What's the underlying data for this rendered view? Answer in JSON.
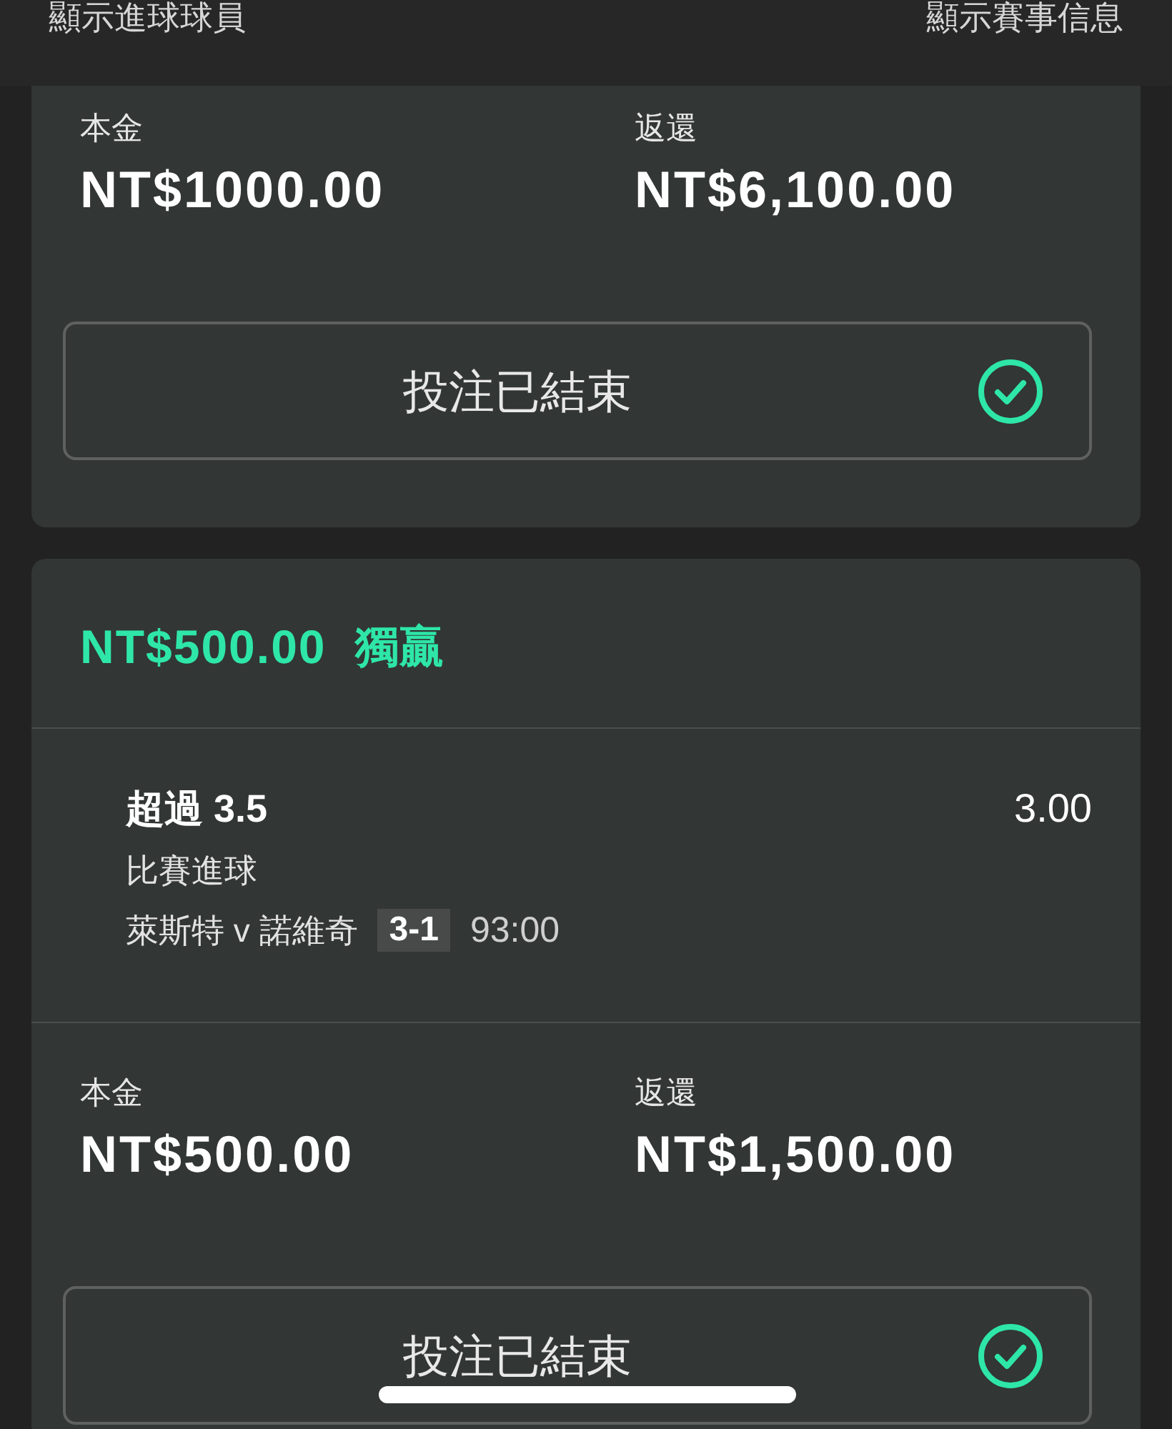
{
  "top_bar": {
    "left_link": "顯示進球球員",
    "right_link": "顯示賽事信息"
  },
  "bets": [
    {
      "stake_label": "本金",
      "stake": "NT$1000.00",
      "return_label": "返還",
      "return": "NT$6,100.00",
      "status": "投注已結束",
      "settled": true
    },
    {
      "amount": "NT$500.00",
      "bet_type": "獨贏",
      "selections": [
        {
          "pick": "超過 3.5",
          "odds": "3.00",
          "market": "比賽進球",
          "match": "萊斯特 v 諾維奇",
          "score": "3-1",
          "time": "93:00"
        }
      ],
      "stake_label": "本金",
      "stake": "NT$500.00",
      "return_label": "返還",
      "return": "NT$1,500.00",
      "status": "投注已結束",
      "settled": true
    }
  ]
}
